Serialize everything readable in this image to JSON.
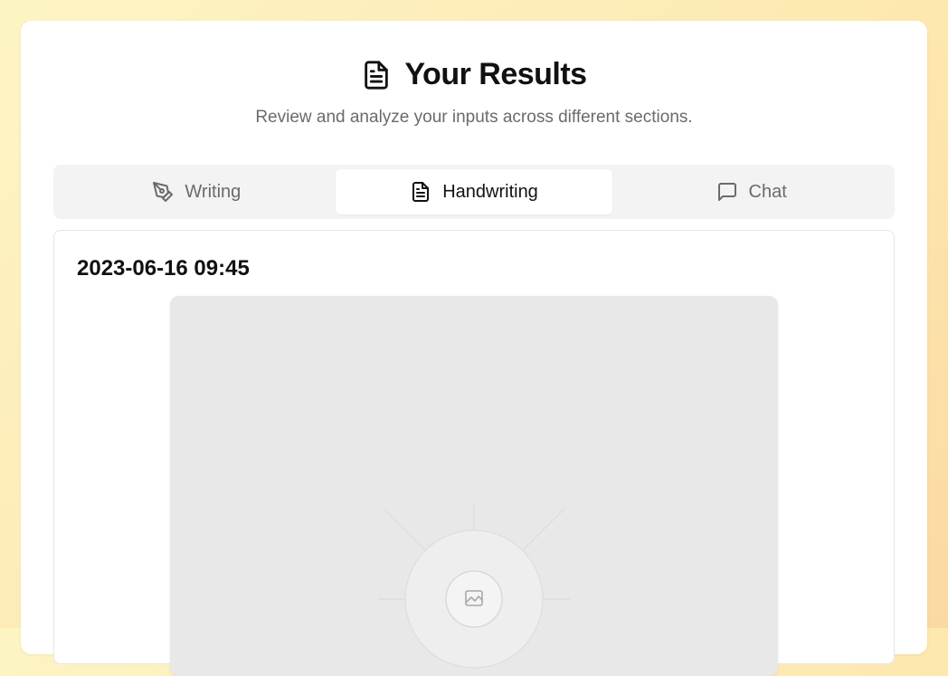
{
  "header": {
    "title": "Your Results",
    "subtitle": "Review and analyze your inputs across different sections.",
    "icon": "document-icon"
  },
  "tabs": [
    {
      "label": "Writing",
      "icon": "pen-icon",
      "active": false
    },
    {
      "label": "Handwriting",
      "icon": "document-icon",
      "active": true
    },
    {
      "label": "Chat",
      "icon": "chat-icon",
      "active": false
    }
  ],
  "entry": {
    "timestamp": "2023-06-16 09:45",
    "image": {
      "icon": "image-placeholder-icon"
    }
  },
  "colors": {
    "background_gradient_start": "#fdf4c4",
    "background_gradient_end": "#fbd9a2",
    "card": "#ffffff",
    "tabs_background": "#f3f3f3",
    "text_primary": "#111111",
    "text_secondary": "#6b6b6b",
    "image_placeholder": "#e8e8e8"
  }
}
